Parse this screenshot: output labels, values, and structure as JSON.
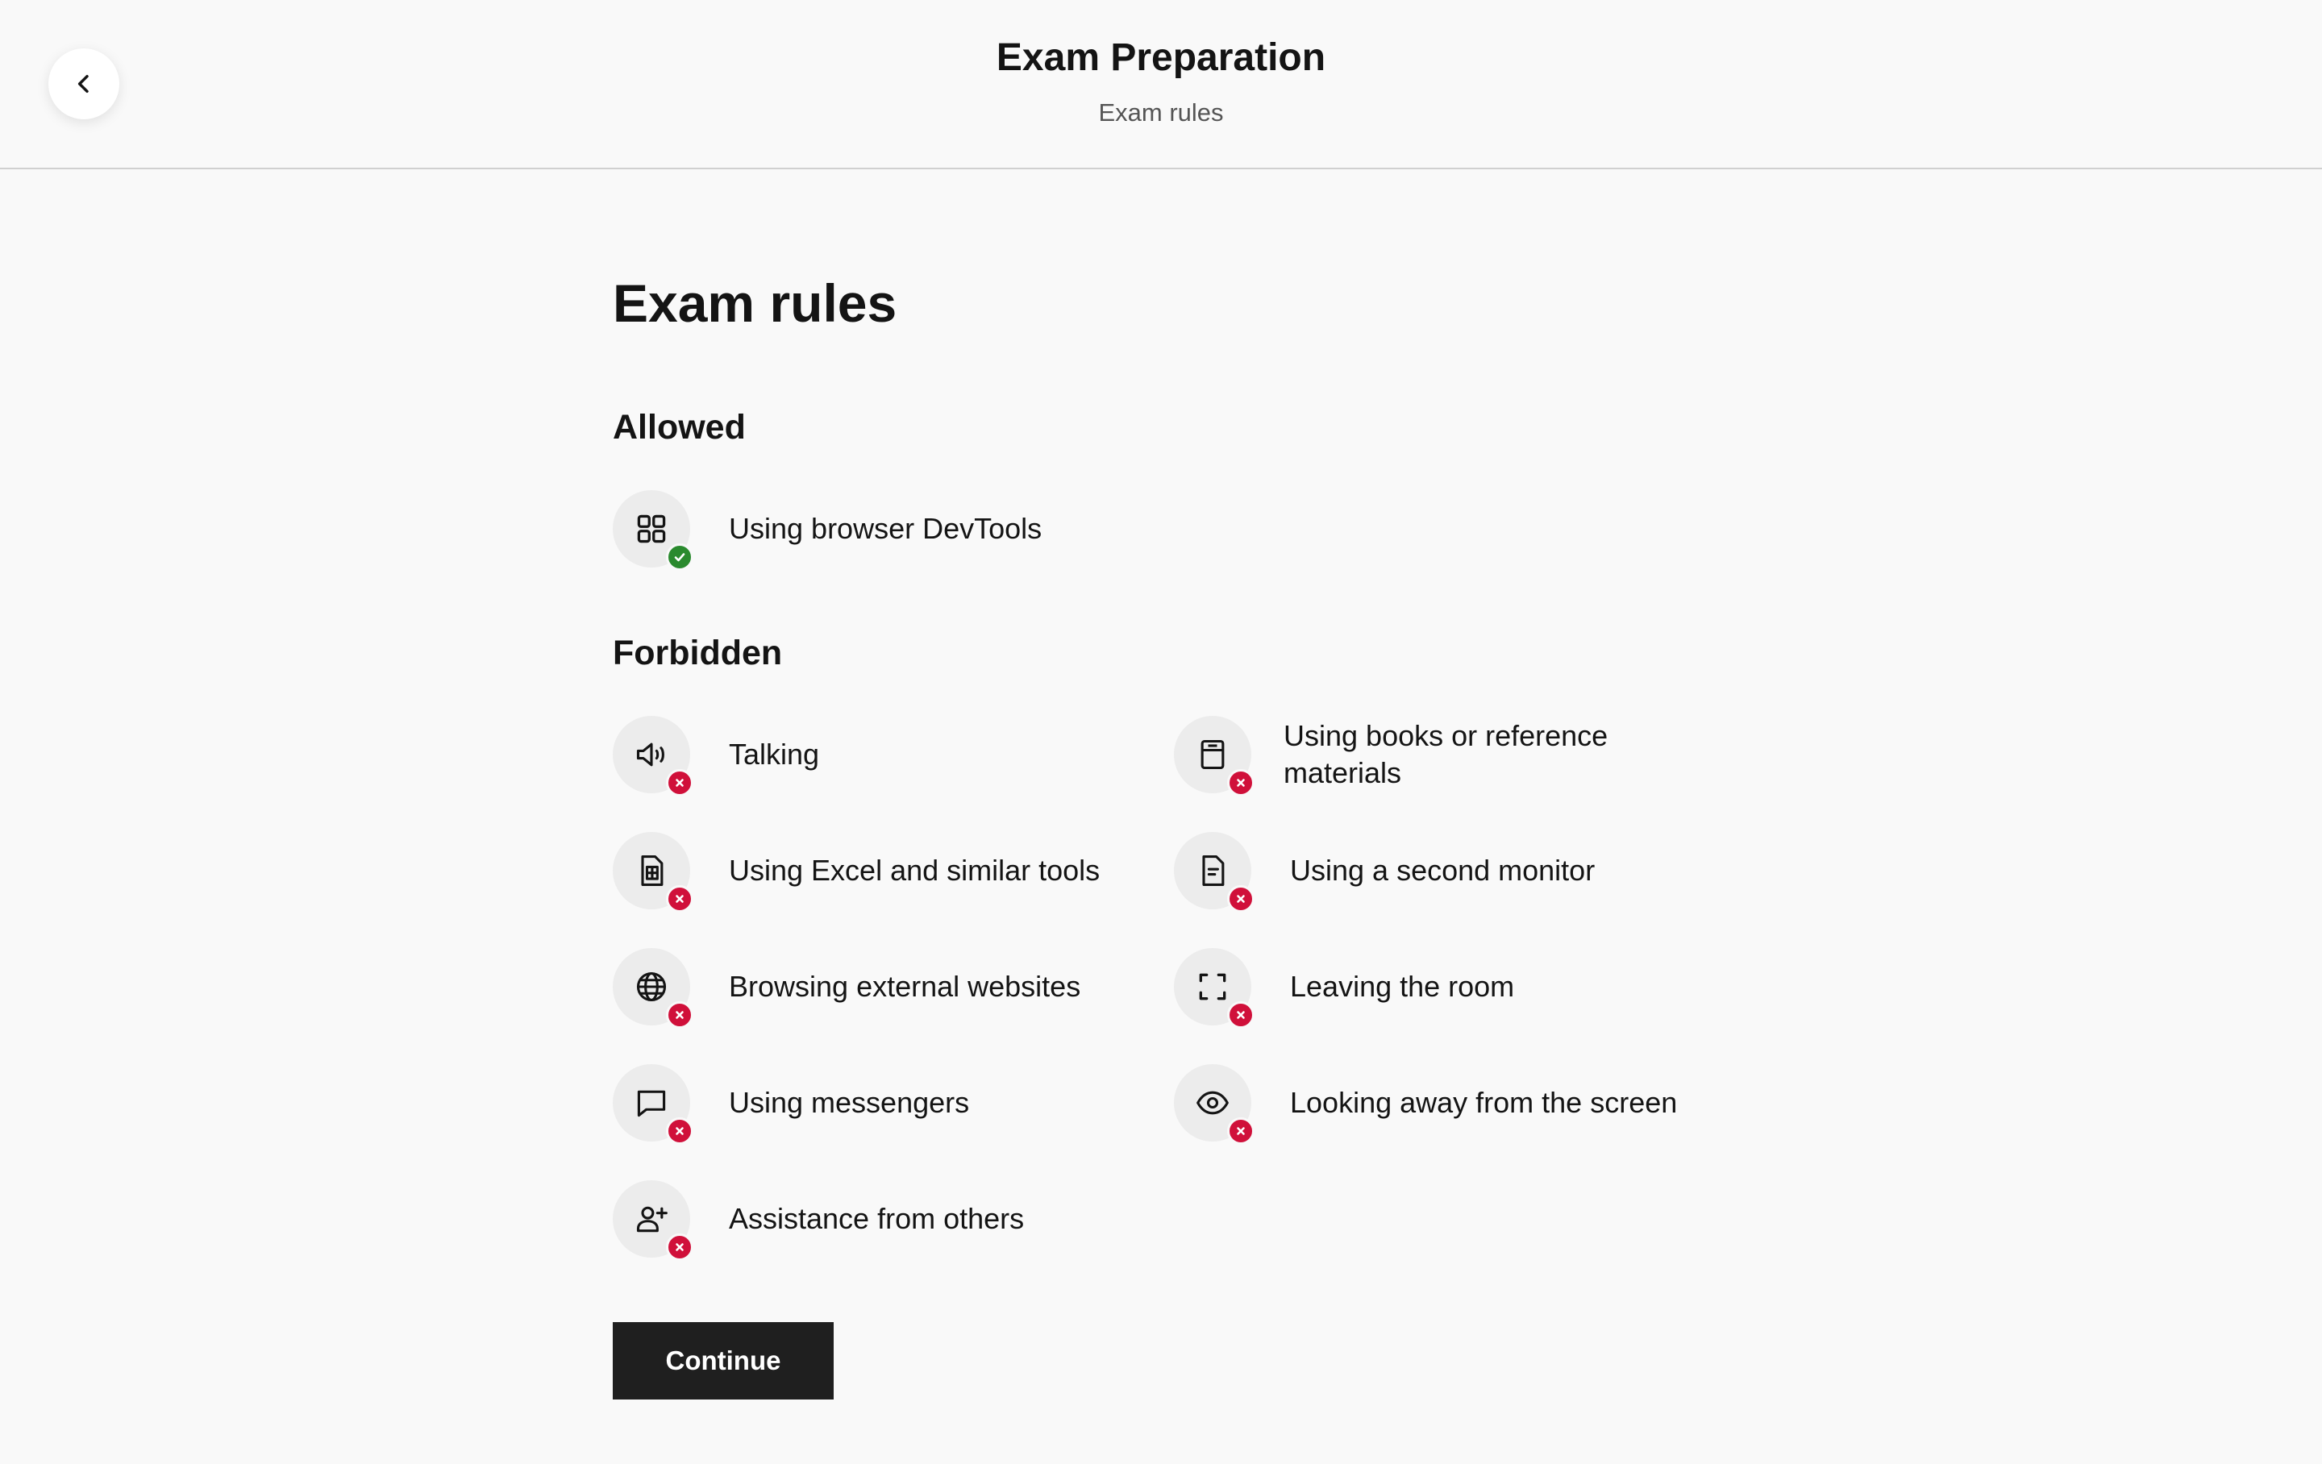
{
  "header": {
    "title": "Exam Preparation",
    "subtitle": "Exam rules",
    "back_icon": "chevron-left-icon"
  },
  "page": {
    "title": "Exam rules"
  },
  "allowed": {
    "title": "Allowed",
    "items": [
      {
        "label": "Using browser DevTools",
        "icon": "grid-icon",
        "status": "allowed"
      }
    ]
  },
  "forbidden": {
    "title": "Forbidden",
    "items": [
      {
        "label": "Talking",
        "icon": "speaker-icon",
        "status": "forbidden"
      },
      {
        "label": "Using books or reference materials",
        "icon": "book-icon",
        "status": "forbidden"
      },
      {
        "label": "Using Excel and similar tools",
        "icon": "spreadsheet-icon",
        "status": "forbidden"
      },
      {
        "label": "Using a second monitor",
        "icon": "document-icon",
        "status": "forbidden"
      },
      {
        "label": "Browsing external websites",
        "icon": "globe-icon",
        "status": "forbidden"
      },
      {
        "label": "Leaving the room",
        "icon": "fullscreen-icon",
        "status": "forbidden"
      },
      {
        "label": "Using messengers",
        "icon": "chat-icon",
        "status": "forbidden"
      },
      {
        "label": "Looking away from the screen",
        "icon": "eye-icon",
        "status": "forbidden"
      },
      {
        "label": "Assistance from others",
        "icon": "user-add-icon",
        "status": "forbidden"
      }
    ]
  },
  "actions": {
    "continue_label": "Continue"
  },
  "colors": {
    "allowed_badge": "#2a8a2e",
    "forbidden_badge": "#d0103a",
    "primary_button": "#1f1f1f",
    "background": "#f9f9f9"
  }
}
